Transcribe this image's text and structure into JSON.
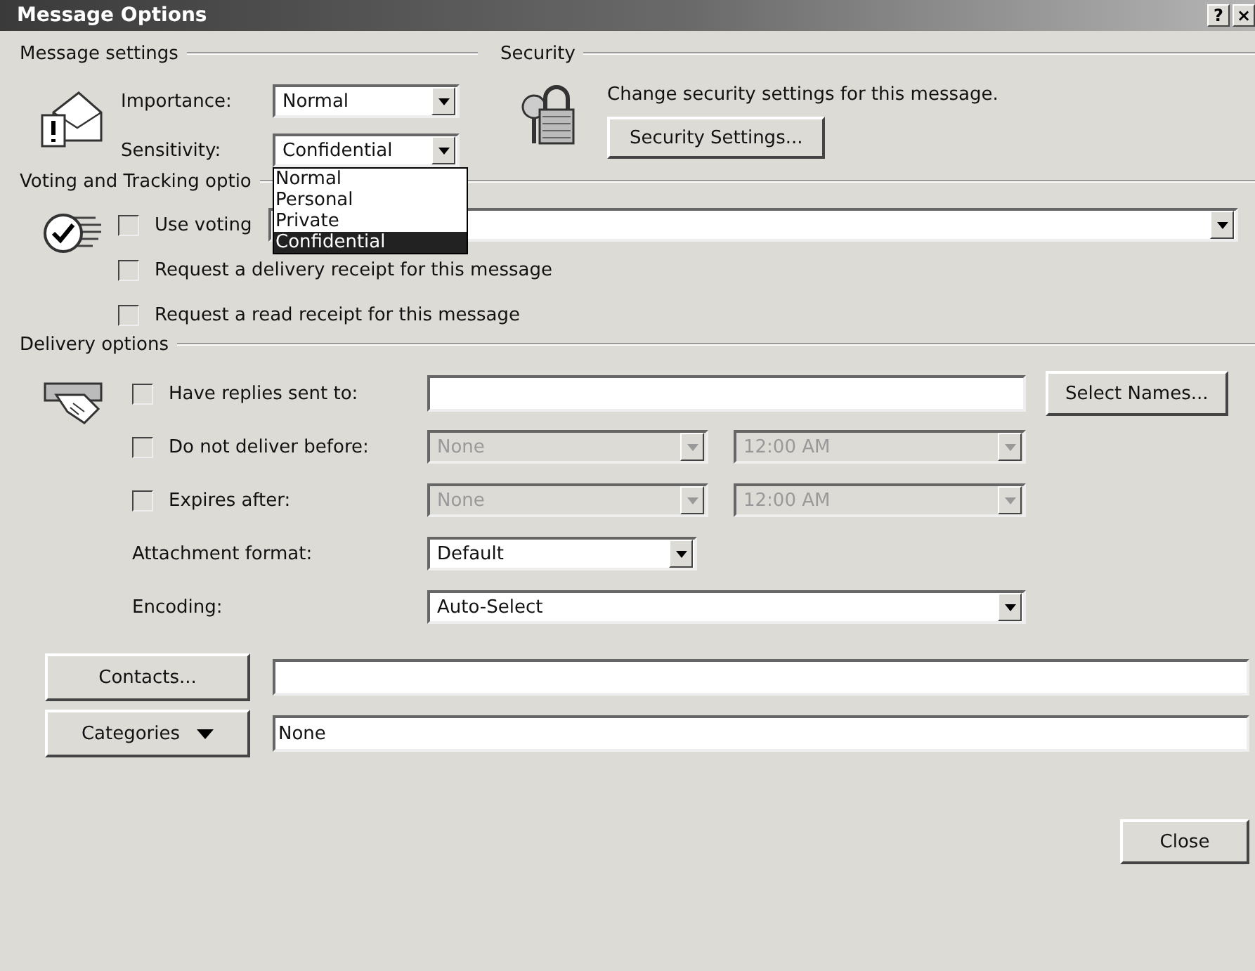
{
  "window": {
    "title": "Message Options",
    "help": "?",
    "close": "×"
  },
  "message_settings": {
    "title": "Message settings",
    "importance": {
      "label": "Importance:",
      "value": "Normal"
    },
    "sensitivity": {
      "label": "Sensitivity:",
      "value": "Confidential",
      "expanded": true,
      "options": [
        {
          "label": "Normal",
          "selected": false
        },
        {
          "label": "Personal",
          "selected": false
        },
        {
          "label": "Private",
          "selected": false
        },
        {
          "label": "Confidential",
          "selected": true
        }
      ]
    }
  },
  "security": {
    "title": "Security",
    "text": "Change security settings for this message.",
    "button": "Security Settings..."
  },
  "voting": {
    "title": "Voting and Tracking optio",
    "options": [
      {
        "kind": "combo",
        "label": "Use voting",
        "checked": false
      },
      {
        "kind": "plain",
        "label": "Request a delivery receipt for this message",
        "checked": false
      },
      {
        "kind": "plain",
        "label": "Request a read receipt for this message",
        "checked": false
      }
    ]
  },
  "delivery": {
    "title": "Delivery options",
    "rows": [
      {
        "kind": "text",
        "label": "Have replies sent to:",
        "checked": false,
        "button": "Select Names..."
      },
      {
        "kind": "datetime",
        "label": "Do not deliver before:",
        "checked": false,
        "date": "None",
        "time": "12:00 AM",
        "disabled": true
      },
      {
        "kind": "datetime",
        "label": "Expires after:",
        "checked": false,
        "date": "None",
        "time": "12:00 AM",
        "disabled": true
      },
      {
        "kind": "select",
        "label": "Attachment format:",
        "value": "Default"
      },
      {
        "kind": "select_wide",
        "label": "Encoding:",
        "value": "Auto-Select"
      }
    ]
  },
  "contacts": {
    "button": "Contacts..."
  },
  "categories": {
    "button": "Categories",
    "value": "None"
  },
  "close_button": "Close"
}
